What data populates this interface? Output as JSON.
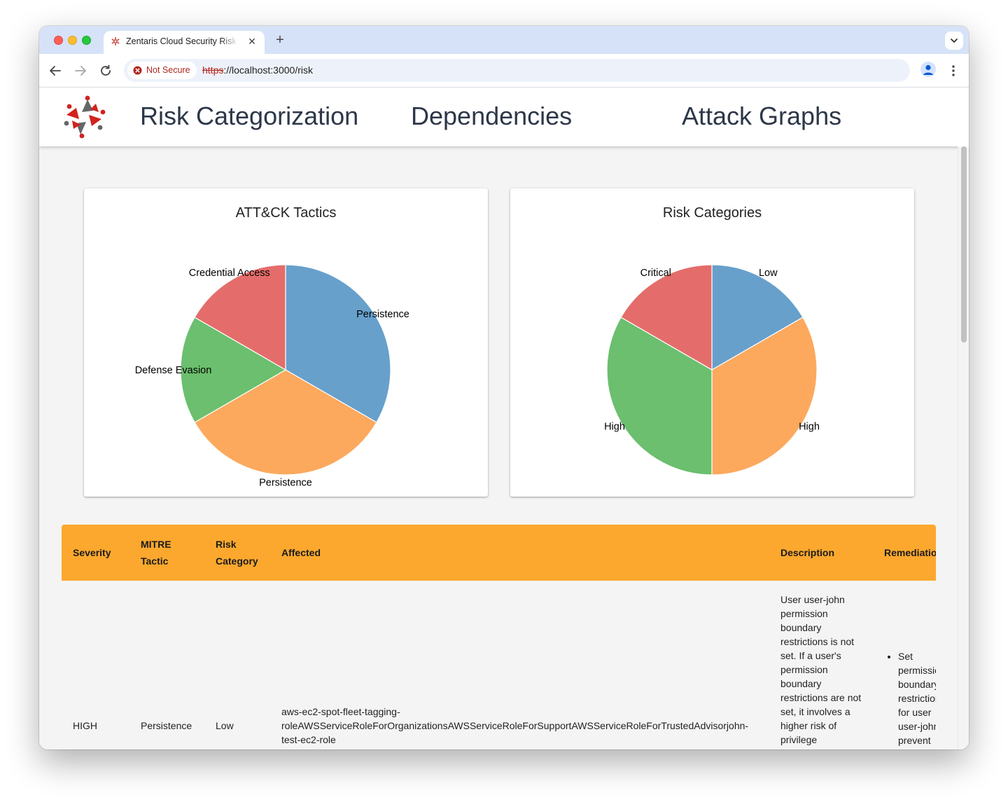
{
  "browser": {
    "tab_title": "Zentaris Cloud Security Risk Assessment",
    "not_secure_label": "Not Secure",
    "url_scheme": "https",
    "url_rest": "://localhost:3000/risk"
  },
  "nav": {
    "items": [
      "Risk Categorization",
      "Dependencies",
      "Attack Graphs"
    ]
  },
  "colors": {
    "blue": "#67a0cb",
    "orange": "#fca95e",
    "green": "#6bbf6e",
    "red": "#e46d6b",
    "table_header": "#fca82e"
  },
  "chart_data": [
    {
      "type": "pie",
      "title": "ATT&CK Tactics",
      "slices": [
        {
          "label": "Persistence",
          "value": 2,
          "color": "#67a0cb"
        },
        {
          "label": "Persistence",
          "value": 2,
          "color": "#fca95e"
        },
        {
          "label": "Defense Evasion",
          "value": 1,
          "color": "#6bbf6e"
        },
        {
          "label": "Credential Access",
          "value": 1,
          "color": "#e46d6b"
        }
      ]
    },
    {
      "type": "pie",
      "title": "Risk Categories",
      "slices": [
        {
          "label": "Low",
          "value": 1,
          "color": "#67a0cb"
        },
        {
          "label": "High",
          "value": 2,
          "color": "#fca95e"
        },
        {
          "label": "High",
          "value": 2,
          "color": "#6bbf6e"
        },
        {
          "label": "Critical",
          "value": 1,
          "color": "#e46d6b"
        }
      ]
    }
  ],
  "table": {
    "headers": {
      "severity": "Severity",
      "tactic_line1": "MITRE",
      "tactic_line2": "Tactic",
      "category_line1": "Risk",
      "category_line2": "Category",
      "affected": "Affected",
      "description": "Description",
      "remediation": "Remediation"
    },
    "rows": [
      {
        "severity": "HIGH",
        "tactic": "Persistence",
        "category": "Low",
        "affected_line1": "aws-ec2-spot-fleet-tagging-",
        "affected_line2": "roleAWSServiceRoleForOrganizationsAWSServiceRoleForSupportAWSServiceRoleForTrustedAdvisorjohn-",
        "affected_line3": "test-ec2-role",
        "description": "User user-john permission boundary restrictions is not set. If a user's permission boundary restrictions are not set, it involves a higher risk of privilege",
        "remediation": "Set permission boundary restrictions for user user-john to prevent"
      }
    ]
  }
}
